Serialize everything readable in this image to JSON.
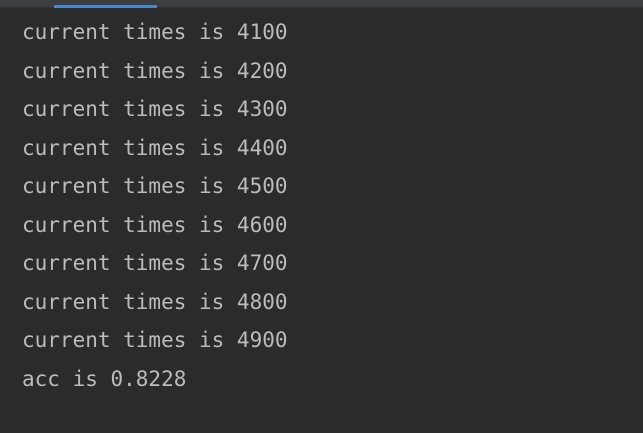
{
  "theme": {
    "background": "#2b2b2b",
    "text_color": "#bbbbbb",
    "tab_strip_color": "#3c3f41",
    "accent": "#4a88c7"
  },
  "console": {
    "lines": [
      "current times is 4100",
      "current times is 4200",
      "current times is 4300",
      "current times is 4400",
      "current times is 4500",
      "current times is 4600",
      "current times is 4700",
      "current times is 4800",
      "current times is 4900",
      "acc is 0.8228"
    ]
  }
}
